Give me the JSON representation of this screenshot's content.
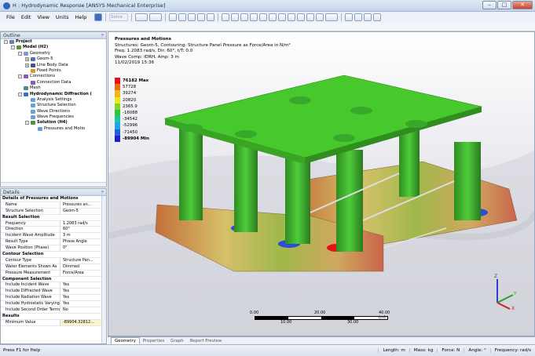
{
  "window": {
    "title": "H : Hydrodynamic Response [ANSYS Mechanical Enterprise]",
    "controls": [
      "–",
      "□",
      "✕"
    ]
  },
  "menu": [
    "File",
    "Edit",
    "View",
    "Units",
    "Help"
  ],
  "toolbar": {
    "solve_label": "Solve"
  },
  "outline": {
    "header": "Outline",
    "items": [
      {
        "label": "Project",
        "level": 0,
        "bold": true,
        "exp": "-",
        "icon": "#6b7fa8"
      },
      {
        "label": "Model (H2)",
        "level": 1,
        "bold": true,
        "exp": "-",
        "icon": "#5b8c3c"
      },
      {
        "label": "Geometry",
        "level": 2,
        "bold": false,
        "exp": "-",
        "icon": "#7a9bd0"
      },
      {
        "label": "Geom-5",
        "level": 3,
        "bold": false,
        "exp": "+",
        "icon": "#4f73b9"
      },
      {
        "label": "Line Body Data",
        "level": 3,
        "bold": false,
        "exp": "+",
        "icon": "#4a4a8c"
      },
      {
        "label": "Fixed Points",
        "level": 3,
        "bold": false,
        "exp": "",
        "icon": "#d69c2a"
      },
      {
        "label": "Connections",
        "level": 2,
        "bold": false,
        "exp": "-",
        "icon": "#8a5bb0"
      },
      {
        "label": "Connection Data",
        "level": 3,
        "bold": false,
        "exp": "",
        "icon": "#8a5bb0"
      },
      {
        "label": "Mesh",
        "level": 2,
        "bold": false,
        "exp": "",
        "icon": "#4e8c8c"
      },
      {
        "label": "Hydrodynamic Diffraction (",
        "level": 2,
        "bold": true,
        "exp": "-",
        "icon": "#3b6fbf"
      },
      {
        "label": "Analysis Settings",
        "level": 3,
        "bold": false,
        "exp": "",
        "icon": "#6aa0d8"
      },
      {
        "label": "Structure Selection",
        "level": 3,
        "bold": false,
        "exp": "",
        "icon": "#6aa0d8"
      },
      {
        "label": "Wave Directions",
        "level": 3,
        "bold": false,
        "exp": "",
        "icon": "#6aa0d8"
      },
      {
        "label": "Wave Frequencies",
        "level": 3,
        "bold": false,
        "exp": "",
        "icon": "#6aa0d8"
      },
      {
        "label": "Solution (H4)",
        "level": 3,
        "bold": true,
        "exp": "-",
        "icon": "#5b8c3c"
      },
      {
        "label": "Pressures and Motio",
        "level": 4,
        "bold": false,
        "exp": "",
        "icon": "#6aa0d8"
      }
    ]
  },
  "details": {
    "header": "Details",
    "title": "Details of Pressures and Motions",
    "sections": [
      {
        "type": "row",
        "k": "Name",
        "v": "Pressures an..."
      },
      {
        "type": "row",
        "k": "Structure Selection",
        "v": "Geom-5"
      },
      {
        "type": "section",
        "k": "Result Selection"
      },
      {
        "type": "row",
        "k": "Frequency",
        "v": "1.2083 rad/s"
      },
      {
        "type": "row",
        "k": "Direction",
        "v": "60°"
      },
      {
        "type": "row",
        "k": "Incident Wave Amplitude",
        "v": "3 m"
      },
      {
        "type": "row",
        "k": "Result Type",
        "v": "Phase Angle"
      },
      {
        "type": "row",
        "k": "Wave Position (Phase)",
        "v": "0°"
      },
      {
        "type": "section",
        "k": "Contour Selection"
      },
      {
        "type": "row",
        "k": "Contour Type",
        "v": "Structure Pan..."
      },
      {
        "type": "row",
        "k": "Water Elements Shown As",
        "v": "Dimmed"
      },
      {
        "type": "row",
        "k": "Pressure Measurement",
        "v": "Force/Area"
      },
      {
        "type": "section",
        "k": "Component Selection"
      },
      {
        "type": "row",
        "k": "Include Incident Wave",
        "v": "Yes"
      },
      {
        "type": "row",
        "k": "Include Diffracted Wave",
        "v": "Yes"
      },
      {
        "type": "row",
        "k": "Include Radiation Wave",
        "v": "Yes"
      },
      {
        "type": "row",
        "k": "Include Hydrostatic Varying",
        "v": "Yes"
      },
      {
        "type": "row",
        "k": "Include Second Order Terms",
        "v": "No"
      },
      {
        "type": "section",
        "k": "Results"
      },
      {
        "type": "row",
        "k": "Minimum Value",
        "v": "-89904.32812...",
        "hl": true
      }
    ]
  },
  "viewport": {
    "title": "Pressures and Motions",
    "lines": [
      "Structures: Geom-5, Contouring: Structure Panel Pressure as Force/Area in N/m²",
      "Freq: 1.2083 rad/s, Dir: 60°, t/T: 0.0",
      "Wave Comp: IDRH, Amp: 3 m",
      "11/02/2019 15:36"
    ],
    "legend": [
      {
        "label": "76182 Max",
        "color": "#e8111a",
        "bold": true
      },
      {
        "label": "57728",
        "color": "#f06a10"
      },
      {
        "label": "39274",
        "color": "#f2b417"
      },
      {
        "label": "20820",
        "color": "#e5e81e"
      },
      {
        "label": "2365.9",
        "color": "#7fd61c"
      },
      {
        "label": "-16088",
        "color": "#2fc43a"
      },
      {
        "label": "-34542",
        "color": "#19c6a6"
      },
      {
        "label": "-52996",
        "color": "#1fa4e6"
      },
      {
        "label": "-71450",
        "color": "#1f5fe2"
      },
      {
        "label": "-89904 Min",
        "color": "#1a22c8",
        "bold": true
      }
    ],
    "scale": {
      "top": [
        "0.00",
        "20.00",
        "40.00 (m)"
      ],
      "bottom": [
        "10.00",
        "30.00"
      ]
    },
    "axes": {
      "z": "Z",
      "y": "Y",
      "x": "X"
    }
  },
  "tabs": [
    "Geometry",
    "Properties",
    "Graph",
    "Report Preview"
  ],
  "status": {
    "help": "Press F1 for Help",
    "items": [
      "Length: m",
      "Mass: kg",
      "Force: N",
      "Angle: °",
      "Frequency: rad/s"
    ]
  }
}
